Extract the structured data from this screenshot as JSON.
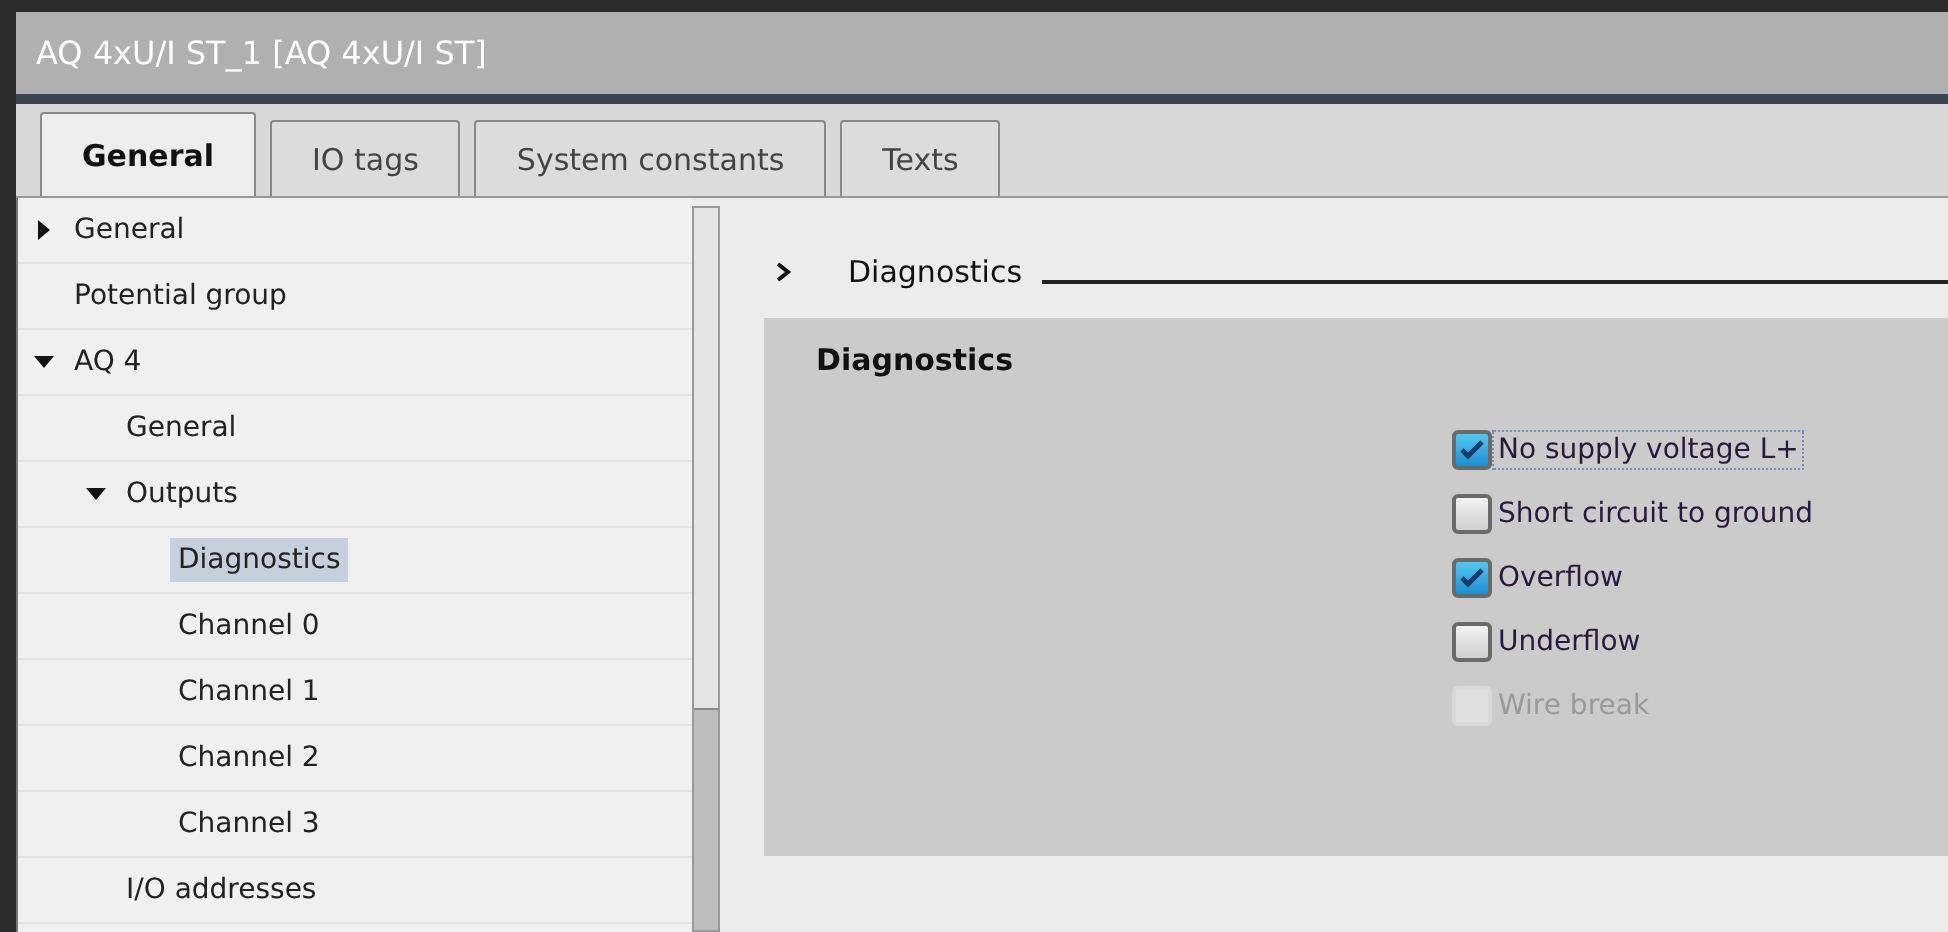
{
  "window": {
    "title": "AQ 4xU/I ST_1 [AQ 4xU/I ST]"
  },
  "tabs": [
    {
      "label": "General",
      "selected": true
    },
    {
      "label": "IO tags",
      "selected": false
    },
    {
      "label": "System constants",
      "selected": false
    },
    {
      "label": "Texts",
      "selected": false
    }
  ],
  "tree": [
    {
      "label": "General",
      "expanded": false,
      "selected": false
    },
    {
      "label": "Potential group",
      "selected": false
    },
    {
      "label": "AQ 4",
      "expanded": true,
      "selected": false,
      "children": [
        {
          "label": "General",
          "selected": false
        },
        {
          "label": "Outputs",
          "expanded": true,
          "selected": false,
          "children": [
            {
              "label": "Diagnostics",
              "selected": true
            },
            {
              "label": "Channel 0",
              "selected": false
            },
            {
              "label": "Channel 1",
              "selected": false
            },
            {
              "label": "Channel 2",
              "selected": false
            },
            {
              "label": "Channel 3",
              "selected": false
            }
          ]
        },
        {
          "label": "I/O addresses",
          "selected": false
        }
      ]
    }
  ],
  "section": {
    "title": "Diagnostics",
    "panel_title": "Diagnostics",
    "options": [
      {
        "label": "No supply voltage L+",
        "checked": true,
        "disabled": false,
        "focused": true
      },
      {
        "label": "Short circuit to ground",
        "checked": false,
        "disabled": false,
        "focused": false
      },
      {
        "label": "Overflow",
        "checked": true,
        "disabled": false,
        "focused": false
      },
      {
        "label": "Underflow",
        "checked": false,
        "disabled": false,
        "focused": false
      },
      {
        "label": "Wire break",
        "checked": false,
        "disabled": true,
        "focused": false
      }
    ]
  }
}
